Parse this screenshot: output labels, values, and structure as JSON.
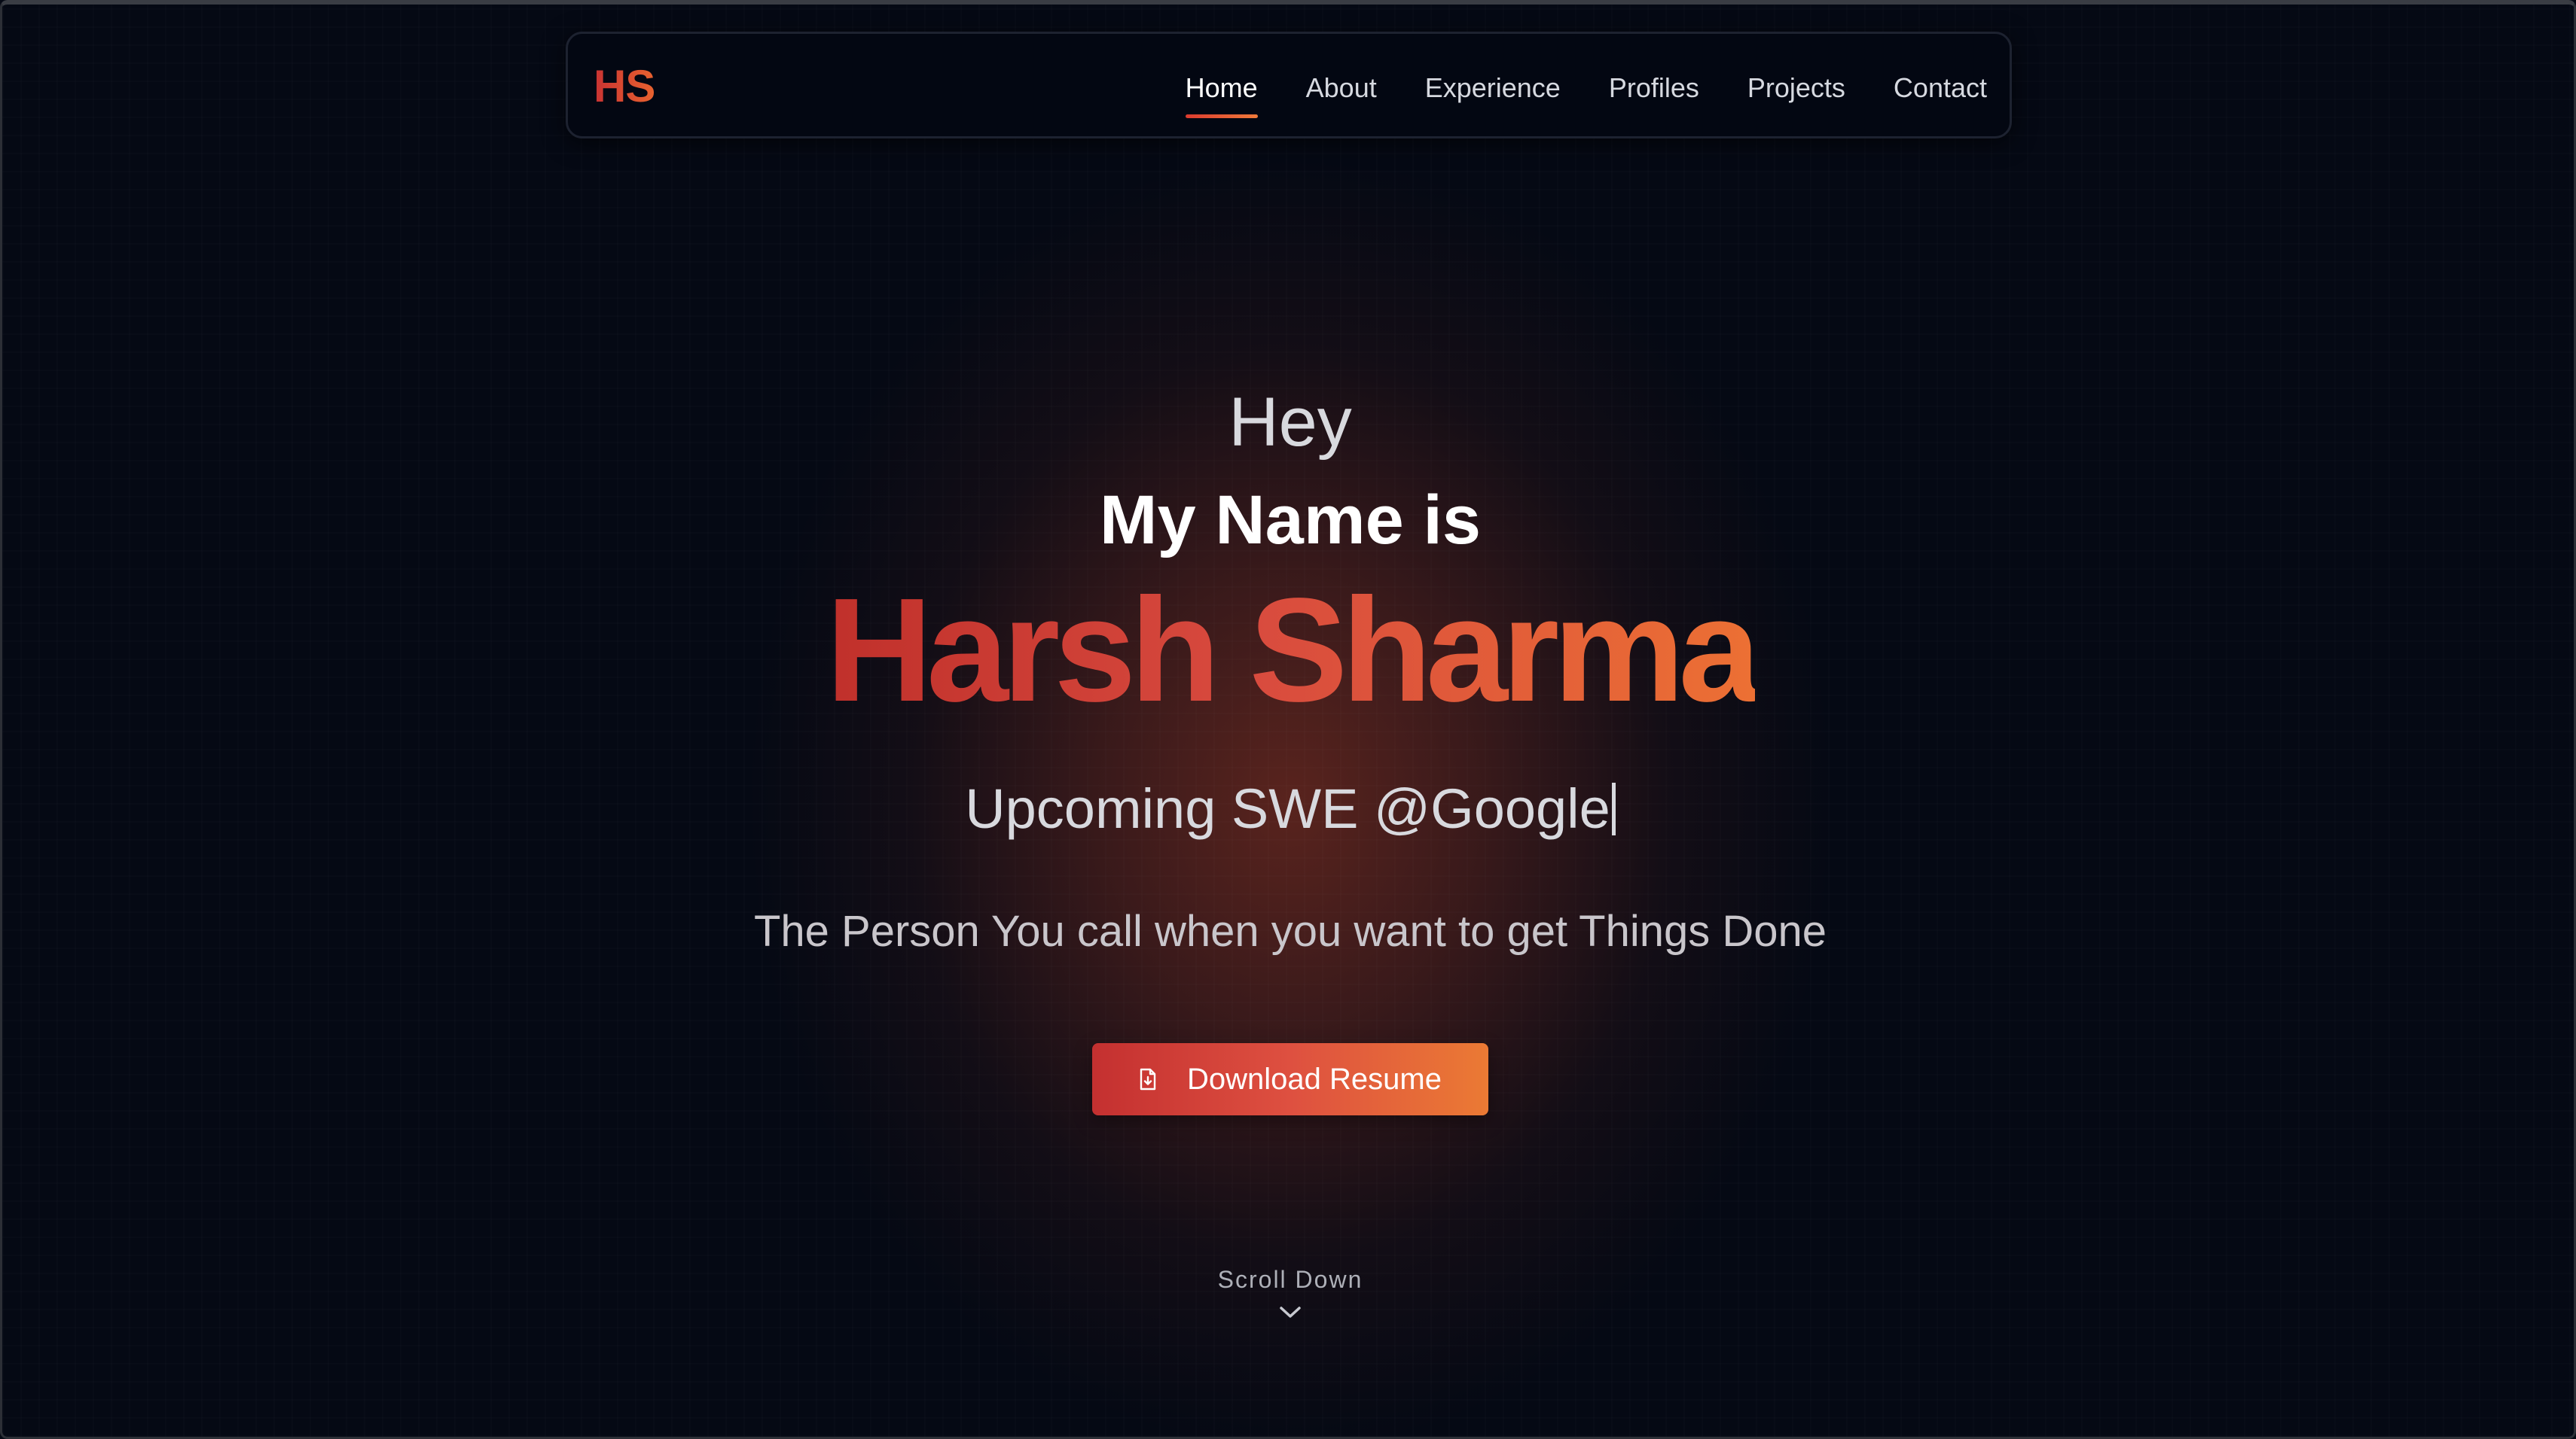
{
  "brand": {
    "logo": "HS",
    "accent_start": "#c83232",
    "accent_end": "#e8622f"
  },
  "nav": {
    "items": [
      {
        "label": "Home",
        "active": true
      },
      {
        "label": "About",
        "active": false
      },
      {
        "label": "Experience",
        "active": false
      },
      {
        "label": "Profiles",
        "active": false
      },
      {
        "label": "Projects",
        "active": false
      },
      {
        "label": "Contact",
        "active": false
      }
    ]
  },
  "hero": {
    "greeting": "Hey",
    "intro": "My Name is",
    "name": "Harsh Sharma",
    "role": "Upcoming SWE @Google",
    "tagline": "The Person You call when you want to get Things Done",
    "cta_label": "Download Resume",
    "cta_icon": "file-download-icon",
    "scroll_label": "Scroll Down",
    "scroll_icon": "chevron-down-icon"
  },
  "colors": {
    "background": "#050914",
    "navbar_bg": "#030712",
    "glow": "#6e2a20"
  }
}
